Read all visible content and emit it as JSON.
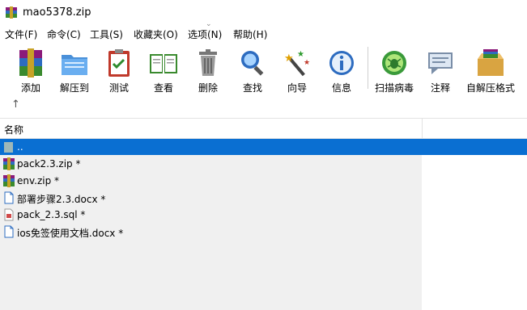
{
  "window": {
    "title": "mao5378.zip"
  },
  "menu": [
    "文件(F)",
    "命令(C)",
    "工具(S)",
    "收藏夹(O)",
    "选项(N)",
    "帮助(H)"
  ],
  "toolbar": {
    "add": "添加",
    "extract_to": "解压到",
    "test": "测试",
    "view": "查看",
    "delete": "删除",
    "find": "查找",
    "wizard": "向导",
    "info": "信息",
    "virus_scan": "扫描病毒",
    "comment": "注释",
    "sfx": "自解压格式"
  },
  "address": {
    "up_arrow": "↑"
  },
  "columns": {
    "name": "名称"
  },
  "files": [
    {
      "name": "..",
      "icon": "folder-up-icon",
      "selected": true
    },
    {
      "name": "pack2.3.zip *",
      "icon": "rar-archive-icon"
    },
    {
      "name": "env.zip *",
      "icon": "rar-archive-icon"
    },
    {
      "name": "部署步骤2.3.docx *",
      "icon": "document-icon"
    },
    {
      "name": "pack_2.3.sql *",
      "icon": "sql-file-icon"
    },
    {
      "name": "ios免签使用文档.docx *",
      "icon": "document-icon"
    }
  ],
  "colors": {
    "selection": "#0a6fd2",
    "list_bg": "#f0f0f0"
  }
}
